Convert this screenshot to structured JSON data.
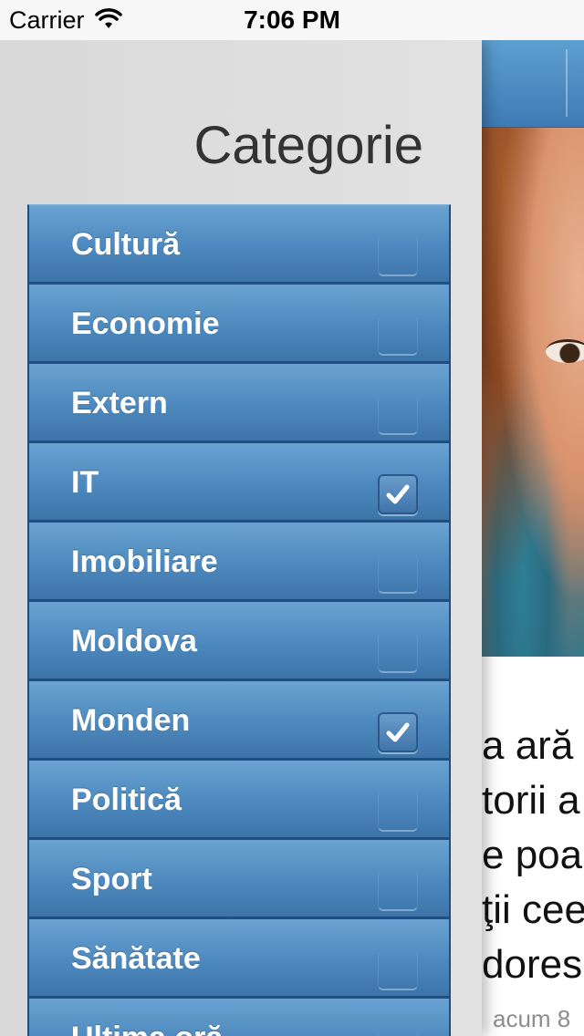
{
  "status_bar": {
    "carrier": "Carrier",
    "time": "7:06 PM"
  },
  "drawer": {
    "title": "Categorie",
    "categories": [
      {
        "label": "Cultură",
        "checked": false
      },
      {
        "label": "Economie",
        "checked": false
      },
      {
        "label": "Extern",
        "checked": false
      },
      {
        "label": "IT",
        "checked": true
      },
      {
        "label": "Imobiliare",
        "checked": false
      },
      {
        "label": "Moldova",
        "checked": false
      },
      {
        "label": "Monden",
        "checked": true
      },
      {
        "label": "Politică",
        "checked": false
      },
      {
        "label": "Sport",
        "checked": false
      },
      {
        "label": "Sănătate",
        "checked": false
      },
      {
        "label": "Ultima oră",
        "checked": false
      }
    ]
  },
  "article": {
    "text_lines": [
      "a ară",
      "torii a",
      "e poa",
      "ţii cee",
      "dores"
    ],
    "meta": "acum 8"
  },
  "colors": {
    "accent": "#4f8bc0",
    "nav_bar": "#4a86be",
    "drawer_bg": "#dedede"
  }
}
